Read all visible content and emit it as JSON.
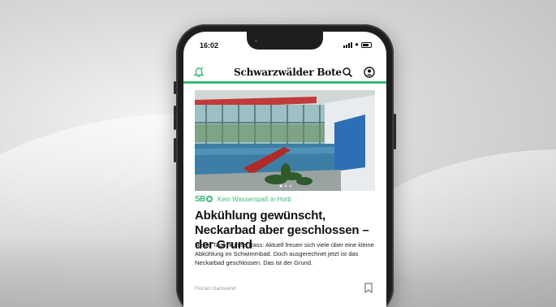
{
  "status_bar": {
    "time": "16:02"
  },
  "app_header": {
    "logo": "Schwarzwälder Bote",
    "icons": [
      "bell-icon",
      "search-icon",
      "account-icon"
    ],
    "accent_color": "#3cb878"
  },
  "article": {
    "source_logo": "SB",
    "kicker": "Kein Wasserspaß in Horb",
    "headline": "Abkühlung gewünscht, Neckarbad aber geschlossen – der Grund",
    "teaser": "Heiße Tage, kühles Nass: Aktuell freuen sich viele über eine kleine Abkühlung im Schwimmbad. Doch ausgerechnet jetzt ist das Neckarbad geschlossen. Das ist der Grund.",
    "author": "Florian Ganswind",
    "image_icon": "indoor-pool-photo",
    "bookmark_icon": "bookmark-icon"
  }
}
